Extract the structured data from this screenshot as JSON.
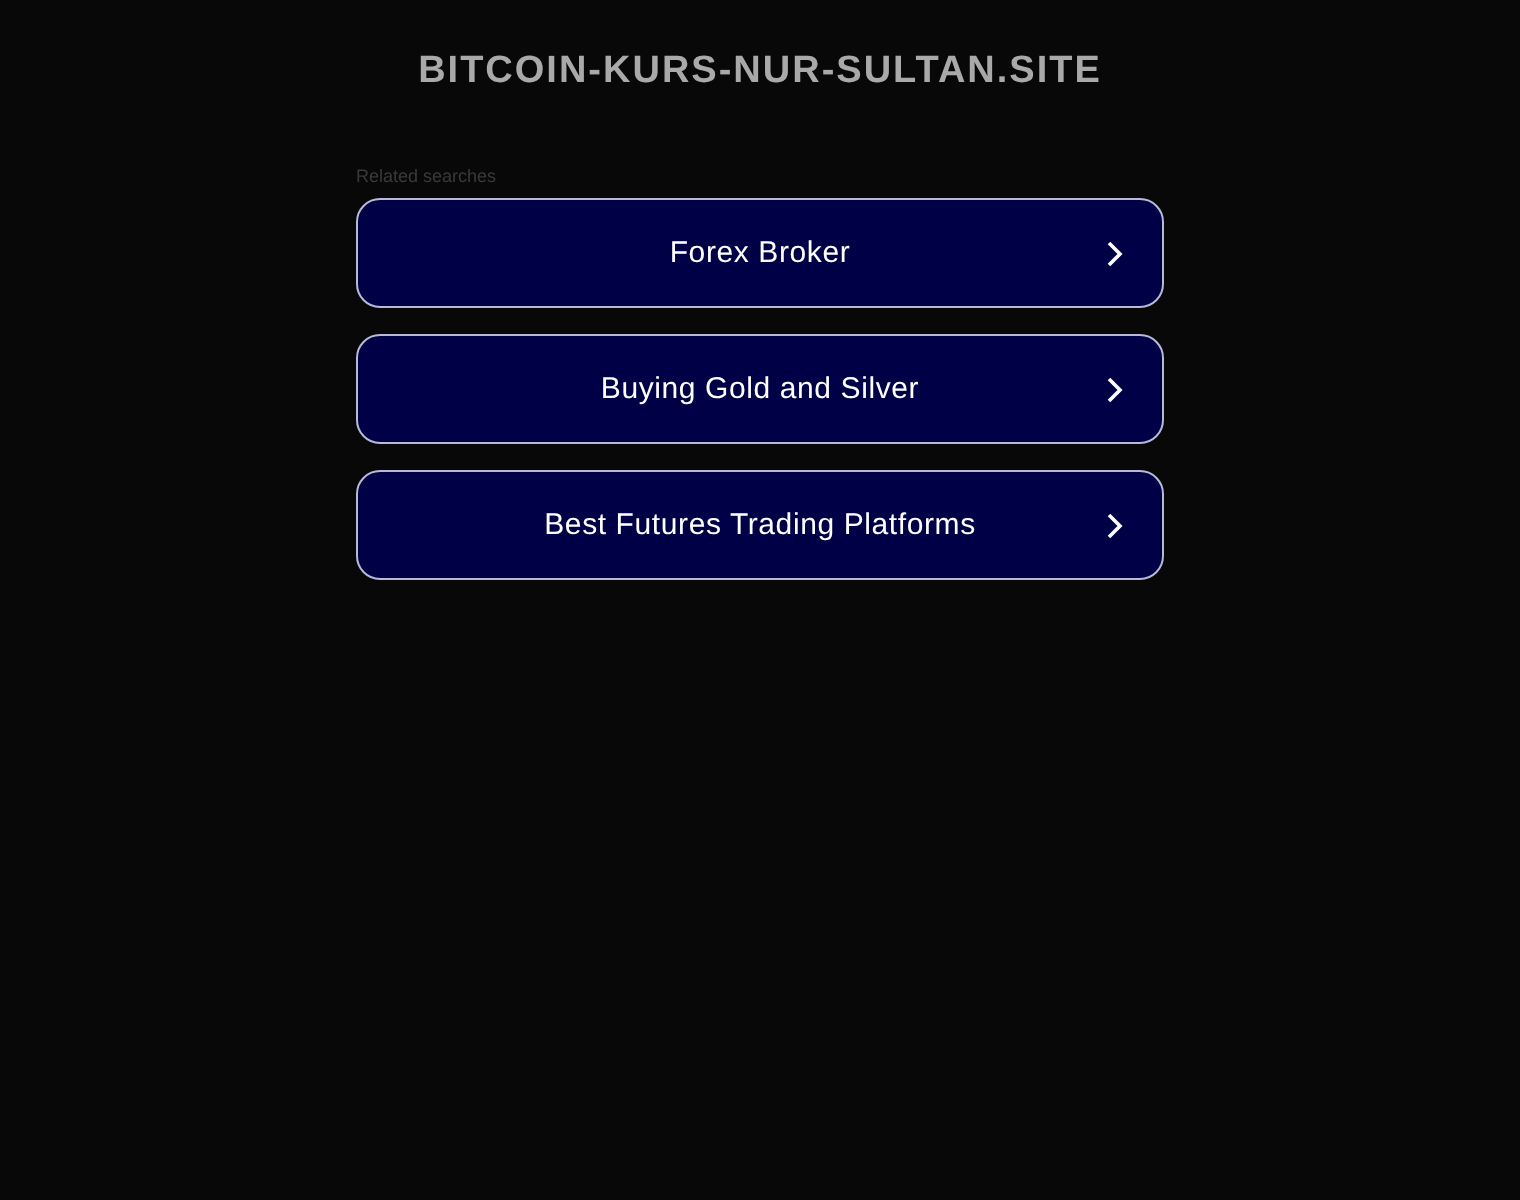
{
  "site_title": "BITCOIN-KURS-NUR-SULTAN.SITE",
  "related": {
    "heading": "Related searches",
    "links": [
      {
        "label": "Forex Broker"
      },
      {
        "label": "Buying Gold and Silver"
      },
      {
        "label": "Best Futures Trading Platforms"
      }
    ]
  }
}
